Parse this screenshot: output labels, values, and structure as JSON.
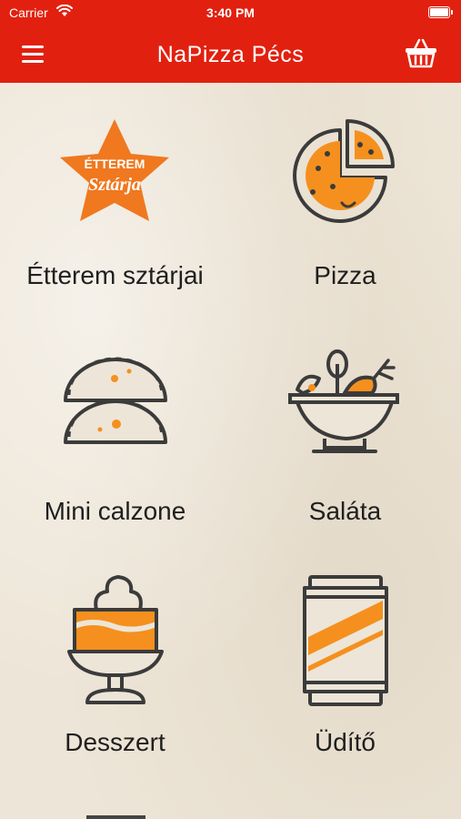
{
  "status_bar": {
    "carrier": "Carrier",
    "time": "3:40 PM"
  },
  "header": {
    "title": "NaPizza Pécs",
    "menu_icon": "hamburger-menu-icon",
    "cart_icon": "shopping-basket-icon"
  },
  "colors": {
    "brand_red": "#e2200f",
    "accent_orange": "#f5901e",
    "outline": "#3b3b3b",
    "background": "#ede5d7"
  },
  "categories": [
    {
      "label": "Étterem sztárjai",
      "icon": "star-badge-icon",
      "badge_line1": "ÉTTEREM",
      "badge_line2": "Sztárja"
    },
    {
      "label": "Pizza",
      "icon": "pizza-icon"
    },
    {
      "label": "Mini calzone",
      "icon": "calzone-icon"
    },
    {
      "label": "Saláta",
      "icon": "salad-bowl-icon"
    },
    {
      "label": "Desszert",
      "icon": "dessert-cup-icon"
    },
    {
      "label": "Üdítő",
      "icon": "soda-can-icon"
    }
  ]
}
